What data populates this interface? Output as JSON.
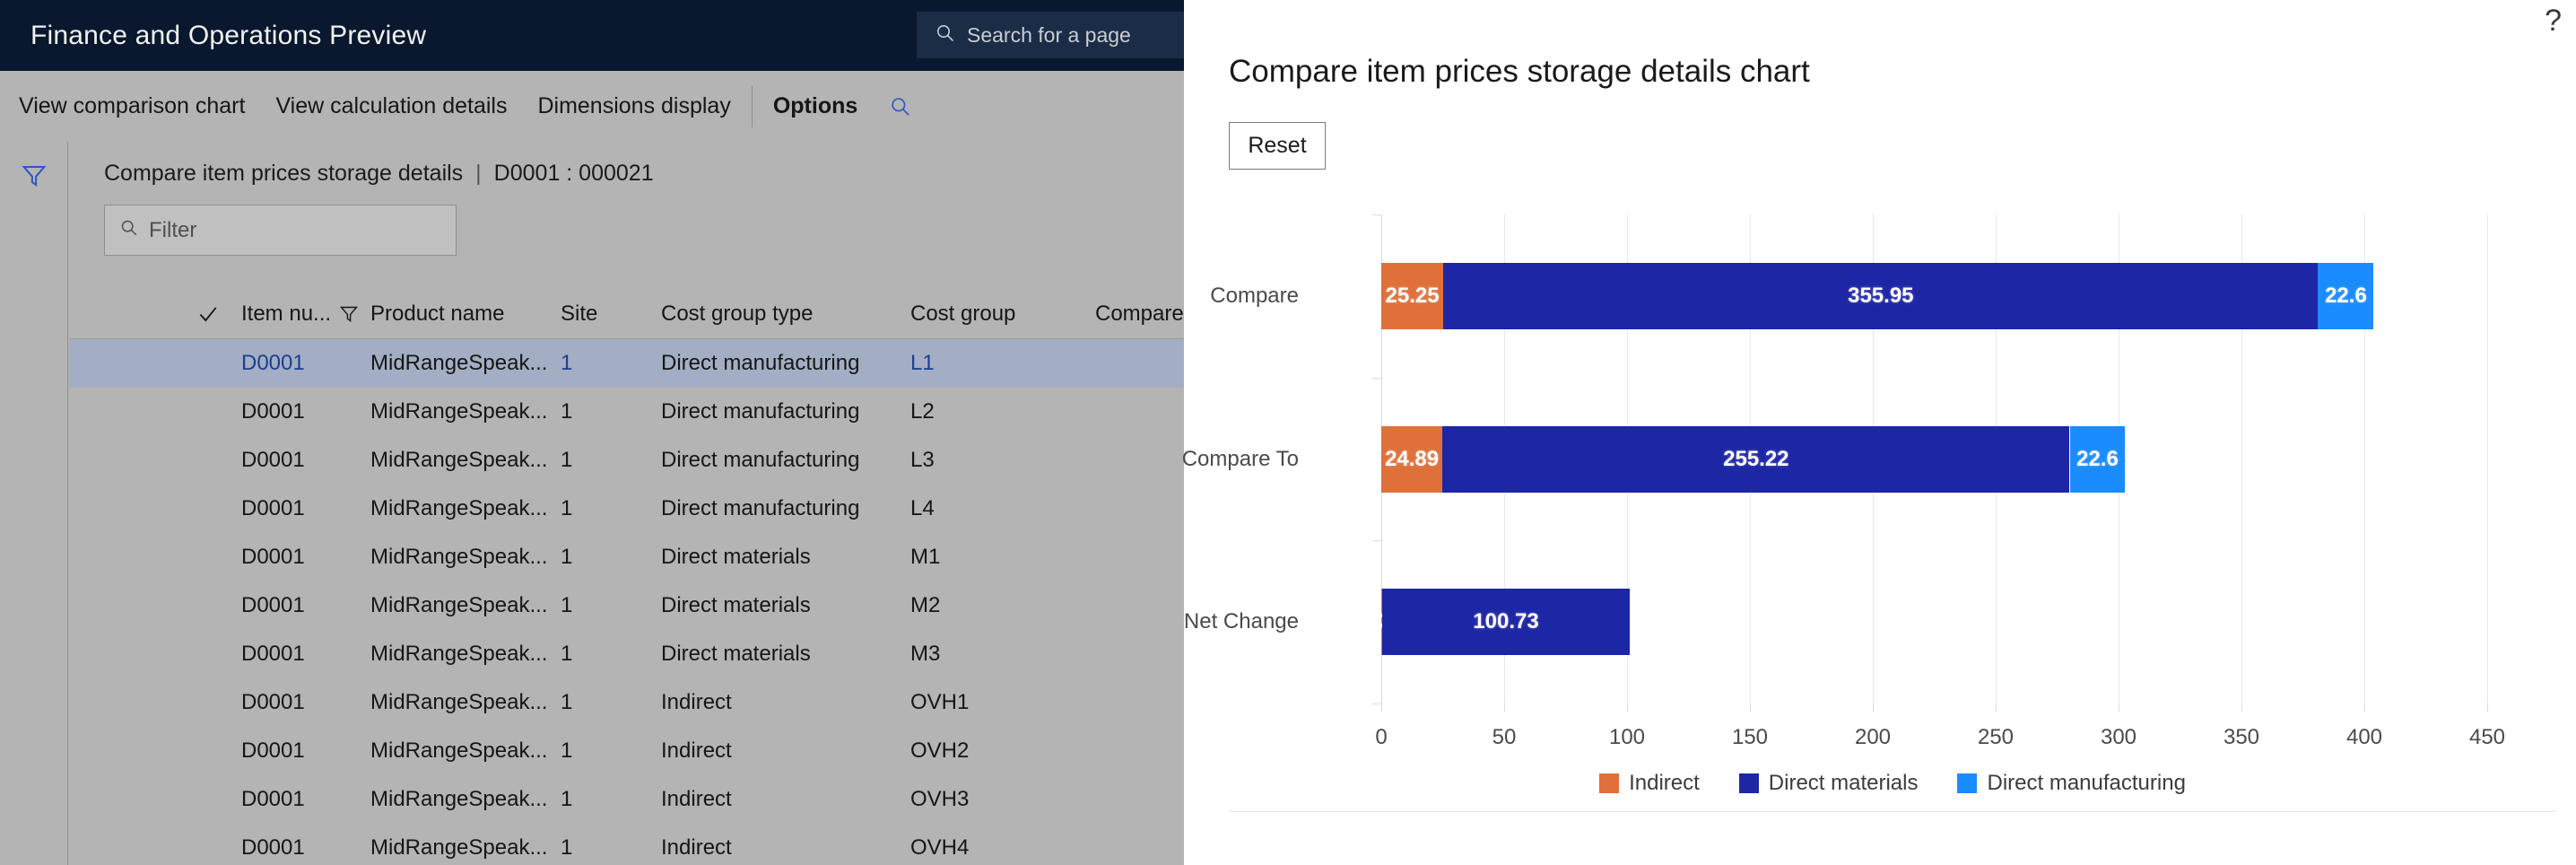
{
  "app": {
    "title": "Finance and Operations Preview",
    "search": {
      "placeholder": "Search for a page",
      "icon": "search-icon"
    }
  },
  "command_bar": {
    "items": [
      {
        "label": "View comparison chart",
        "bold": false
      },
      {
        "label": "View calculation details",
        "bold": false
      },
      {
        "label": "Dimensions display",
        "bold": false
      },
      {
        "label": "Options",
        "bold": true
      }
    ],
    "search_icon": "search-icon"
  },
  "workspace": {
    "filter_rail_icon": "filter-funnel-icon",
    "breadcrumb": {
      "page": "Compare item prices storage details",
      "separator": "|",
      "record": "D0001 : 000021"
    },
    "filter": {
      "placeholder": "Filter",
      "value": "",
      "icon": "search-icon"
    }
  },
  "grid": {
    "columns": [
      {
        "key": "check",
        "label": ""
      },
      {
        "key": "item",
        "label": "Item nu..."
      },
      {
        "key": "colfilter",
        "label": ""
      },
      {
        "key": "product",
        "label": "Product name"
      },
      {
        "key": "site",
        "label": "Site"
      },
      {
        "key": "cost_group_type",
        "label": "Cost group type"
      },
      {
        "key": "cost_group",
        "label": "Cost group"
      },
      {
        "key": "compare_price",
        "label": "Compare: Price qu"
      }
    ],
    "rows": [
      {
        "item": "D0001",
        "product": "MidRangeSpeak...",
        "site": "1",
        "cost_group_type": "Direct manufacturing",
        "cost_group": "L1",
        "selected": true
      },
      {
        "item": "D0001",
        "product": "MidRangeSpeak...",
        "site": "1",
        "cost_group_type": "Direct manufacturing",
        "cost_group": "L2",
        "selected": false
      },
      {
        "item": "D0001",
        "product": "MidRangeSpeak...",
        "site": "1",
        "cost_group_type": "Direct manufacturing",
        "cost_group": "L3",
        "selected": false
      },
      {
        "item": "D0001",
        "product": "MidRangeSpeak...",
        "site": "1",
        "cost_group_type": "Direct manufacturing",
        "cost_group": "L4",
        "selected": false
      },
      {
        "item": "D0001",
        "product": "MidRangeSpeak...",
        "site": "1",
        "cost_group_type": "Direct materials",
        "cost_group": "M1",
        "selected": false
      },
      {
        "item": "D0001",
        "product": "MidRangeSpeak...",
        "site": "1",
        "cost_group_type": "Direct materials",
        "cost_group": "M2",
        "selected": false
      },
      {
        "item": "D0001",
        "product": "MidRangeSpeak...",
        "site": "1",
        "cost_group_type": "Direct materials",
        "cost_group": "M3",
        "selected": false
      },
      {
        "item": "D0001",
        "product": "MidRangeSpeak...",
        "site": "1",
        "cost_group_type": "Indirect",
        "cost_group": "OVH1",
        "selected": false
      },
      {
        "item": "D0001",
        "product": "MidRangeSpeak...",
        "site": "1",
        "cost_group_type": "Indirect",
        "cost_group": "OVH2",
        "selected": false
      },
      {
        "item": "D0001",
        "product": "MidRangeSpeak...",
        "site": "1",
        "cost_group_type": "Indirect",
        "cost_group": "OVH3",
        "selected": false
      },
      {
        "item": "D0001",
        "product": "MidRangeSpeak...",
        "site": "1",
        "cost_group_type": "Indirect",
        "cost_group": "OVH4",
        "selected": false
      }
    ],
    "check_glyph": "✓",
    "column_filter_glyph": "filter-funnel-icon"
  },
  "chart_panel": {
    "title": "Compare item prices storage details chart",
    "reset_label": "Reset",
    "help_icon": "?"
  },
  "chart_data": {
    "type": "bar",
    "orientation": "horizontal",
    "stacked": true,
    "title": "Compare item prices storage details chart",
    "xlabel": "",
    "ylabel": "",
    "categories": [
      "Compare",
      "Compare To",
      "Net Change"
    ],
    "series": [
      {
        "name": "Indirect",
        "color": "#E0703A",
        "values": [
          25.25,
          24.89,
          0.36
        ]
      },
      {
        "name": "Direct materials",
        "color": "#1D26A5",
        "values": [
          355.95,
          255.22,
          100.73
        ]
      },
      {
        "name": "Direct manufacturing",
        "color": "#1A8CFF",
        "values": [
          22.6,
          22.6,
          0
        ]
      }
    ],
    "bar_labels": [
      [
        "25.25",
        "355.95",
        "22.6"
      ],
      [
        "24.89",
        "255.22",
        "22.6"
      ],
      [
        "0.36",
        "100.73",
        "0"
      ]
    ],
    "totals": [
      403.8,
      302.71,
      101.09
    ],
    "xlim": [
      0,
      450
    ],
    "xticks": [
      0,
      50,
      100,
      150,
      200,
      250,
      300,
      350,
      400,
      450
    ],
    "xtick_labels": [
      "0",
      "50",
      "100",
      "150",
      "200",
      "250",
      "300",
      "350",
      "400",
      "450"
    ],
    "grid": true,
    "legend_position": "bottom",
    "legend": [
      "Indirect",
      "Direct materials",
      "Direct manufacturing"
    ]
  },
  "colors": {
    "title_bar": "#09182E",
    "chrome": "#B4B4B4",
    "selection": "#A3AEC4",
    "link": "#1F4AA8",
    "indirect": "#E0703A",
    "direct_materials": "#1D26A5",
    "direct_manufacturing": "#1A8CFF"
  }
}
